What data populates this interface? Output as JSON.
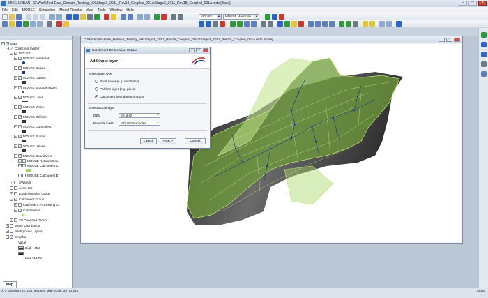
{
  "window": {
    "title": "MIKE URBAN - C:\\Work\\Test-Data_Domain_Testing_MX\\Stage3_2011_Rev18_Coupled_001a\\Stage3_2011_Rev18_Coupled_001a.mdb [Base]"
  },
  "menu": [
    "File",
    "Edit",
    "MOUSE",
    "Simulation",
    "Model Results",
    "View",
    "Tools",
    "Window",
    "Help"
  ],
  "toolbar": {
    "select1": "MOUSE",
    "select2": "MOUSE Manholes",
    "colors": {
      "blue": "#2f63c6",
      "green": "#2f9a3a",
      "red": "#c8392b",
      "yellow": "#e3c43c",
      "grey": "#6f7a88"
    }
  },
  "tree": {
    "tab": "Map",
    "items": [
      {
        "label": "Map",
        "checked": false
      },
      {
        "label": "Collection System",
        "checked": true
      },
      {
        "label": "MOUSE",
        "checked": true
      },
      {
        "label": "MOUSE Manholes",
        "checked": true
      },
      {
        "label": "MOUSE Basins",
        "checked": true
      },
      {
        "label": "MOUSE Outlets",
        "checked": true
      },
      {
        "label": "MOUSE Storage Nodes",
        "checked": true
      },
      {
        "label": "MOUSE Links",
        "checked": true
      },
      {
        "label": "MOUSE Weirs",
        "checked": true
      },
      {
        "label": "MOUSE Orifices",
        "checked": true
      },
      {
        "label": "MOUSE Curb Inlets",
        "checked": true
      },
      {
        "label": "MOUSE Pumps",
        "checked": true
      },
      {
        "label": "MOUSE Valves",
        "checked": true
      },
      {
        "label": "MOUSE Boundaries",
        "checked": true
      },
      {
        "label": "MOUSE Network Bou",
        "checked": false
      },
      {
        "label": "MOUSE Catchment C",
        "checked": true
      },
      {
        "label": "MOUSE Catchment E",
        "checked": false
      },
      {
        "label": "SWMM5",
        "checked": false
      },
      {
        "label": "Asset CS",
        "checked": false
      },
      {
        "label": "Load Allocation Group",
        "checked": false
      },
      {
        "label": "Catchment Group",
        "checked": true
      },
      {
        "label": "Catchment Processing G",
        "checked": false
      },
      {
        "label": "Catchments",
        "checked": true
      },
      {
        "label": "2D Overland Group",
        "checked": false
      },
      {
        "label": "Water Distribution",
        "checked": false
      },
      {
        "label": "Background Layers",
        "checked": false
      },
      {
        "label": "Sm.dfs2",
        "checked": true
      }
    ],
    "legend": {
      "value_label": "Value",
      "high": "High : 45,5",
      "low": "Low : 10,75"
    }
  },
  "document": {
    "title": "C:\\Work\\Test-Data_Domain_Testing_MX\\Stage3_2011_Rev18_Coupled_001a\\Stage3_2011_Rev18_Coupled_001a.mdb [Base]"
  },
  "wizard": {
    "title": "Catchment Delineation Wizard",
    "header": "Add input layer",
    "select_layer_type": "Select layer type",
    "options": [
      "Point Layer (e.g. manholes)",
      "Polyline layer (e.g. pipes)",
      "Catchment boundaries on DEM"
    ],
    "selected_option": 2,
    "select_actual_layer": "Select actual layer",
    "dem_label": "DEM",
    "dem_value": "Sm.dfs2",
    "network_label": "Network inlets",
    "network_value": "MOUSE Manholes",
    "back": "< Back",
    "next": "Next >",
    "cancel": "Cancel"
  },
  "statusbar": {
    "text": "X,Y: 189895,722; 1867954,848    Map Scale: 29711,2267",
    "mode": "SCRL"
  }
}
